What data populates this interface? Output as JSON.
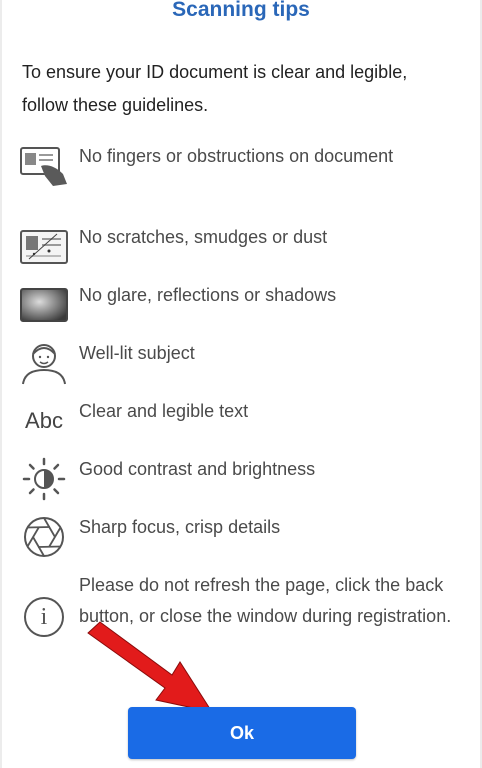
{
  "dialog": {
    "title": "Scanning tips",
    "intro": "To ensure your ID document is clear and legible, follow these guidelines."
  },
  "tips": [
    {
      "icon": "finger-on-document-icon",
      "label": "No fingers or obstructions on document"
    },
    {
      "icon": "scratched-document-icon",
      "label": "No scratches, smudges or dust"
    },
    {
      "icon": "glare-document-icon",
      "label": "No glare, reflections or shadows"
    },
    {
      "icon": "person-portrait-icon",
      "label": "Well-lit subject"
    },
    {
      "icon": "abc-text-icon",
      "icon_text": "Abc",
      "label": "Clear and legible text"
    },
    {
      "icon": "contrast-brightness-icon",
      "label": "Good contrast and brightness"
    },
    {
      "icon": "camera-aperture-icon",
      "label": "Sharp focus, crisp details"
    },
    {
      "icon": "info-icon",
      "icon_text": "i",
      "label": "Please do not refresh the page, click the back button, or close the window during registration."
    }
  ],
  "actions": {
    "ok_label": "Ok"
  },
  "colors": {
    "title": "#2a67b8",
    "button": "#1a6be6",
    "annotation_arrow": "#e21b1b"
  }
}
